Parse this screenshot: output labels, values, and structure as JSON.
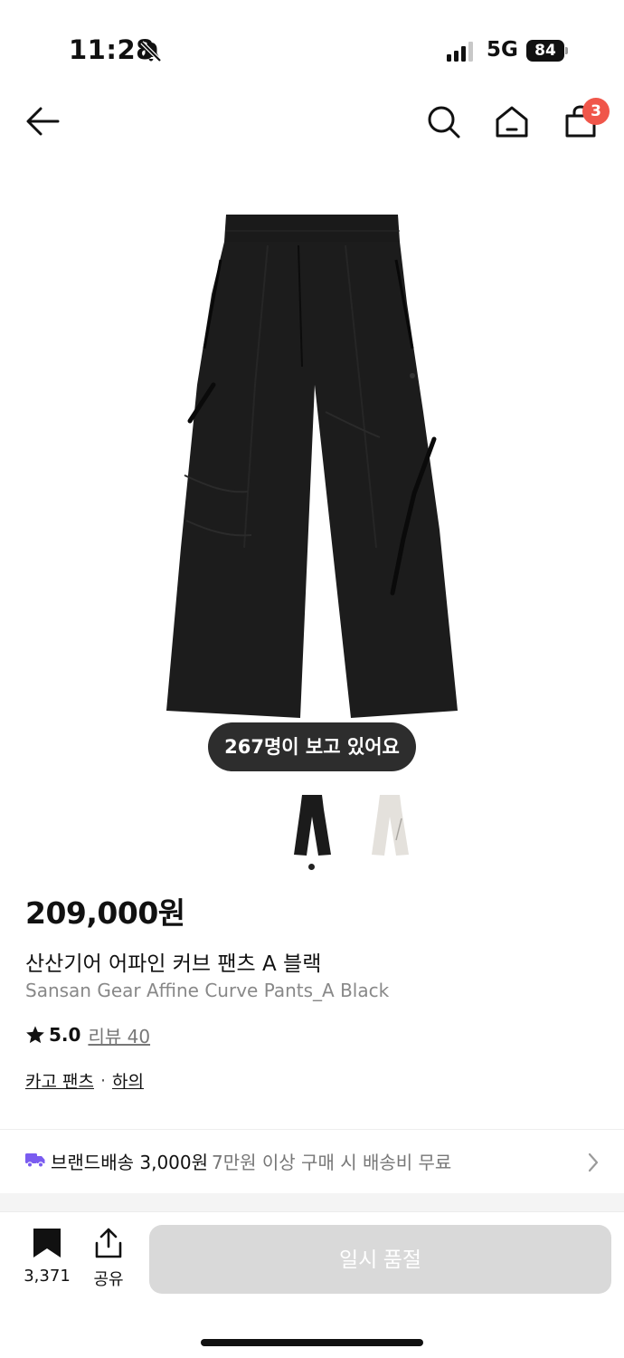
{
  "status_bar": {
    "time": "11:28",
    "network": "5G",
    "battery": "84"
  },
  "nav": {
    "cart_count": "3"
  },
  "product": {
    "viewers": "267명이 보고 있어요",
    "price": "209,000원",
    "name_ko": "산산기어 어파인 커브 팬츠 A 블랙",
    "name_en": "Sansan Gear Affine Curve Pants_A Black",
    "rating": "5.0",
    "review_label": "리뷰 40",
    "category_1": "카고 팬츠",
    "category_sep": "·",
    "category_2": "하의",
    "colors": [
      "#1b1b1b",
      "#e4e1dc"
    ]
  },
  "shipping": {
    "label": "브랜드배송 3,000원",
    "note": "7만원 이상 구매 시 배송비 무료",
    "accent": "#7a5cf0"
  },
  "bottom_bar": {
    "save_count": "3,371",
    "share_label": "공유",
    "soldout_label": "일시 품절"
  }
}
